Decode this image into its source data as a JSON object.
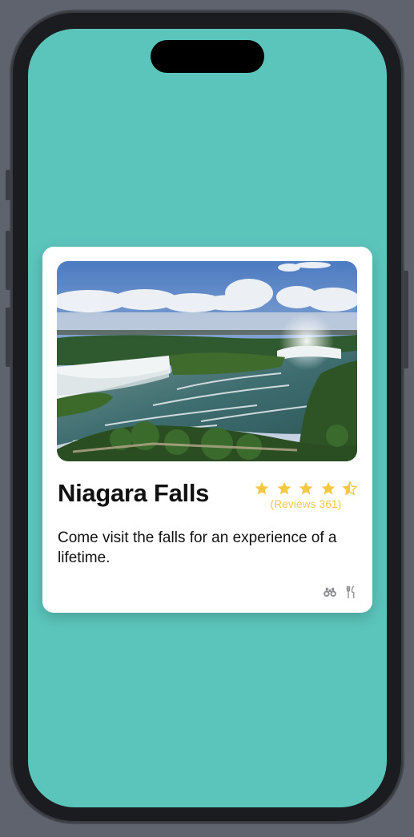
{
  "theme": {
    "background": "#5bc5bc",
    "card": "#ffffff",
    "star_color": "#f5c842",
    "icon_color": "#8e8e93"
  },
  "card": {
    "image": "niagara-falls-photo",
    "title": "Niagara Falls",
    "rating": {
      "value": 4.5,
      "max": 5
    },
    "reviews_label": "(Reviews 361)",
    "description": "Come visit the falls for an experience of a lifetime.",
    "amenities": [
      "binoculars-icon",
      "fork-knife-icon"
    ]
  }
}
